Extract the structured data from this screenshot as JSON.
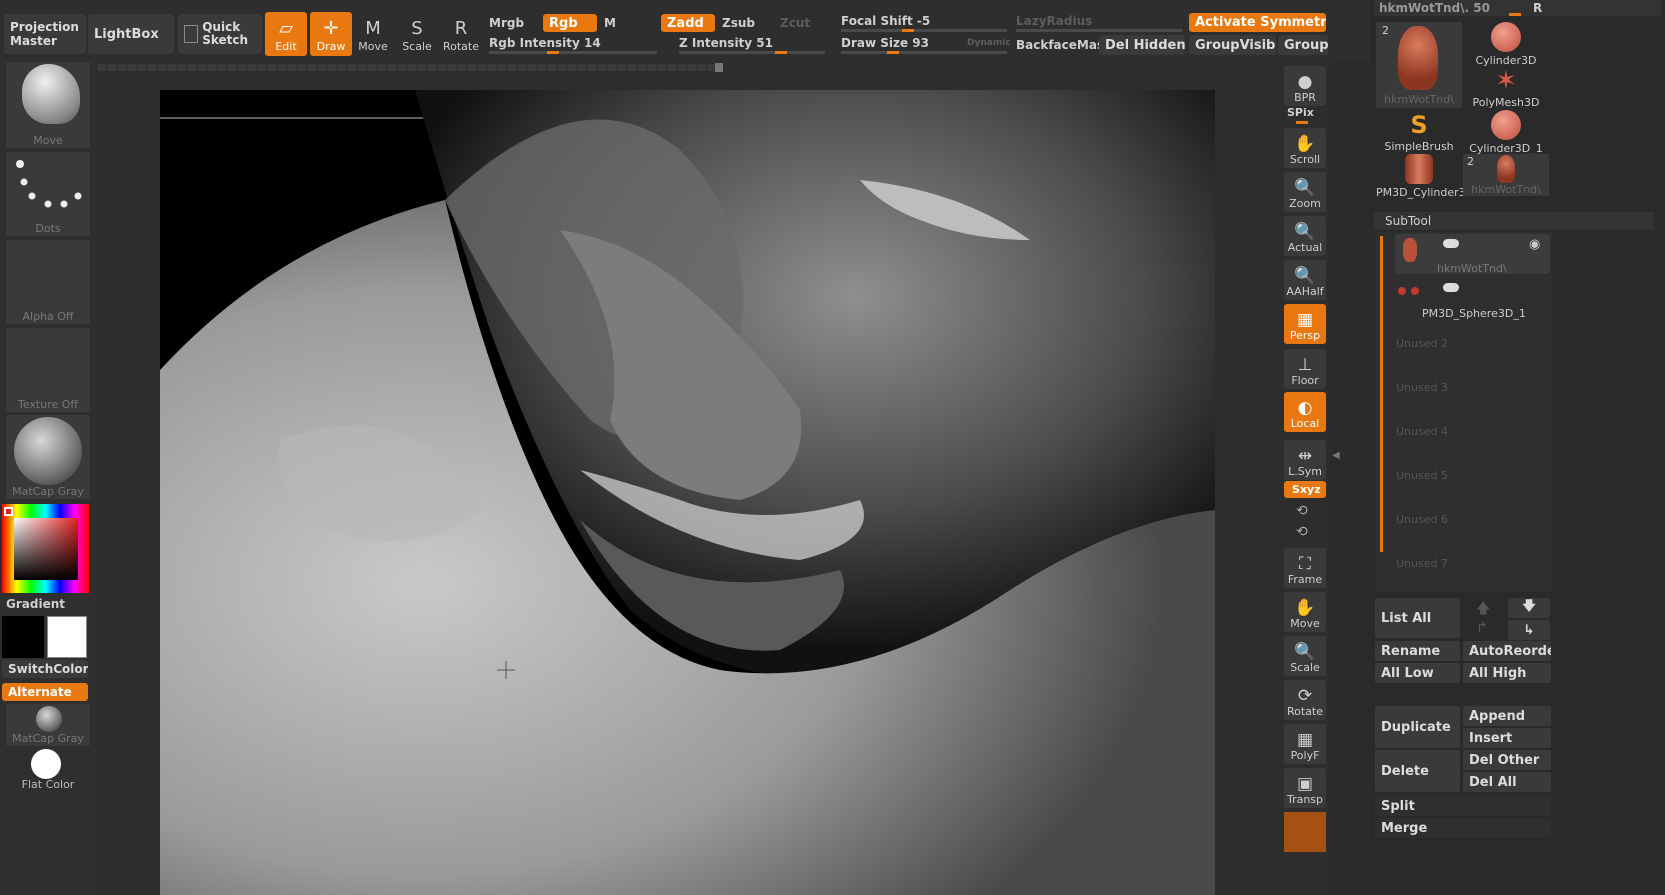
{
  "top": {
    "projection_master": "Projection Master",
    "lightbox": "LightBox",
    "quick_sketch": "Quick Sketch",
    "tools": [
      {
        "label": "Edit",
        "icon": "edit-icon",
        "active": true
      },
      {
        "label": "Draw",
        "icon": "draw-icon",
        "active": true
      },
      {
        "label": "Move",
        "icon": "move-icon",
        "active": false
      },
      {
        "label": "Scale",
        "icon": "scale-icon",
        "active": false
      },
      {
        "label": "Rotate",
        "icon": "rotate-icon",
        "active": false
      }
    ],
    "mrgb": "Mrgb",
    "rgb": "Rgb",
    "m": "M",
    "zadd": "Zadd",
    "zsub": "Zsub",
    "zcut": "Zcut",
    "rgb_intensity": "Rgb Intensity 14",
    "z_intensity": "Z Intensity 51",
    "focal_shift": "Focal Shift -5",
    "draw_size": "Draw Size 93",
    "dynamic": "Dynamic",
    "lazy_radius": "LazyRadius",
    "backface": "BackfaceMas",
    "del_hidden": "Del Hidden",
    "activate_symmetry": "Activate Symmetry",
    "group_visible": "GroupVisible",
    "group": "Group",
    "accent": "#e8780f"
  },
  "left": {
    "move_brush": "Move",
    "dots": "Dots",
    "alpha": "Alpha Off",
    "texture": "Texture Off",
    "matcap1": "MatCap Gray",
    "gradient": "Gradient",
    "switch_color": "SwitchColor",
    "alternate": "Alternate",
    "matcap2": "MatCap Gray",
    "flat_color": "Flat Color"
  },
  "right": [
    {
      "label": "BPR",
      "icon": "bpr-icon",
      "active": false
    },
    {
      "label": "Scroll",
      "icon": "scroll-icon",
      "active": false
    },
    {
      "label": "Zoom",
      "icon": "zoom-icon",
      "active": false
    },
    {
      "label": "Actual",
      "icon": "actual-icon",
      "active": false
    },
    {
      "label": "AAHalf",
      "icon": "aahalf-icon",
      "active": false
    },
    {
      "label": "Persp",
      "icon": "persp-icon",
      "active": true
    },
    {
      "label": "Floor",
      "icon": "floor-icon",
      "active": false
    },
    {
      "label": "Local",
      "icon": "local-icon",
      "active": true
    },
    {
      "label": "L.Sym",
      "icon": "lsym-icon",
      "active": false
    },
    {
      "label": "Frame",
      "icon": "frame-icon",
      "active": false
    },
    {
      "label": "Move",
      "icon": "move-icon",
      "active": false
    },
    {
      "label": "Scale",
      "icon": "scale-icon",
      "active": false
    },
    {
      "label": "Rotate",
      "icon": "rotate-icon",
      "active": false
    },
    {
      "label": "PolyF",
      "icon": "polyf-icon",
      "active": false
    },
    {
      "label": "Transp",
      "icon": "transp-icon",
      "active": false
    }
  ],
  "right_extra": {
    "spix": "SPix",
    "xyz": "Sxyz"
  },
  "palette": {
    "header": "hkmWotTnd\\. 50",
    "r": "R",
    "tools": [
      {
        "label": "hkmWotTnd\\",
        "count": "2"
      },
      {
        "label": "Cylinder3D"
      },
      {
        "label": "PolyMesh3D"
      },
      {
        "label": "SimpleBrush"
      },
      {
        "label": "Cylinder3D_1"
      },
      {
        "label": "PM3D_Cylinder3I"
      },
      {
        "label": "hkmWotTnd\\",
        "count": "2"
      }
    ],
    "subtool_title": "SubTool",
    "subtools": [
      "hkmWotTnd\\",
      "PM3D_Sphere3D_1"
    ],
    "unused": [
      "Unused 2",
      "Unused 3",
      "Unused 4",
      "Unused 5",
      "Unused 6",
      "Unused 7"
    ],
    "buttons": {
      "list_all": "List All",
      "rename": "Rename",
      "auto_reorder": "AutoReorder",
      "all_low": "All Low",
      "all_high": "All High",
      "duplicate": "Duplicate",
      "append": "Append",
      "insert": "Insert",
      "delete": "Delete",
      "del_other": "Del Other",
      "del_all": "Del All",
      "split": "Split",
      "merge": "Merge"
    }
  }
}
